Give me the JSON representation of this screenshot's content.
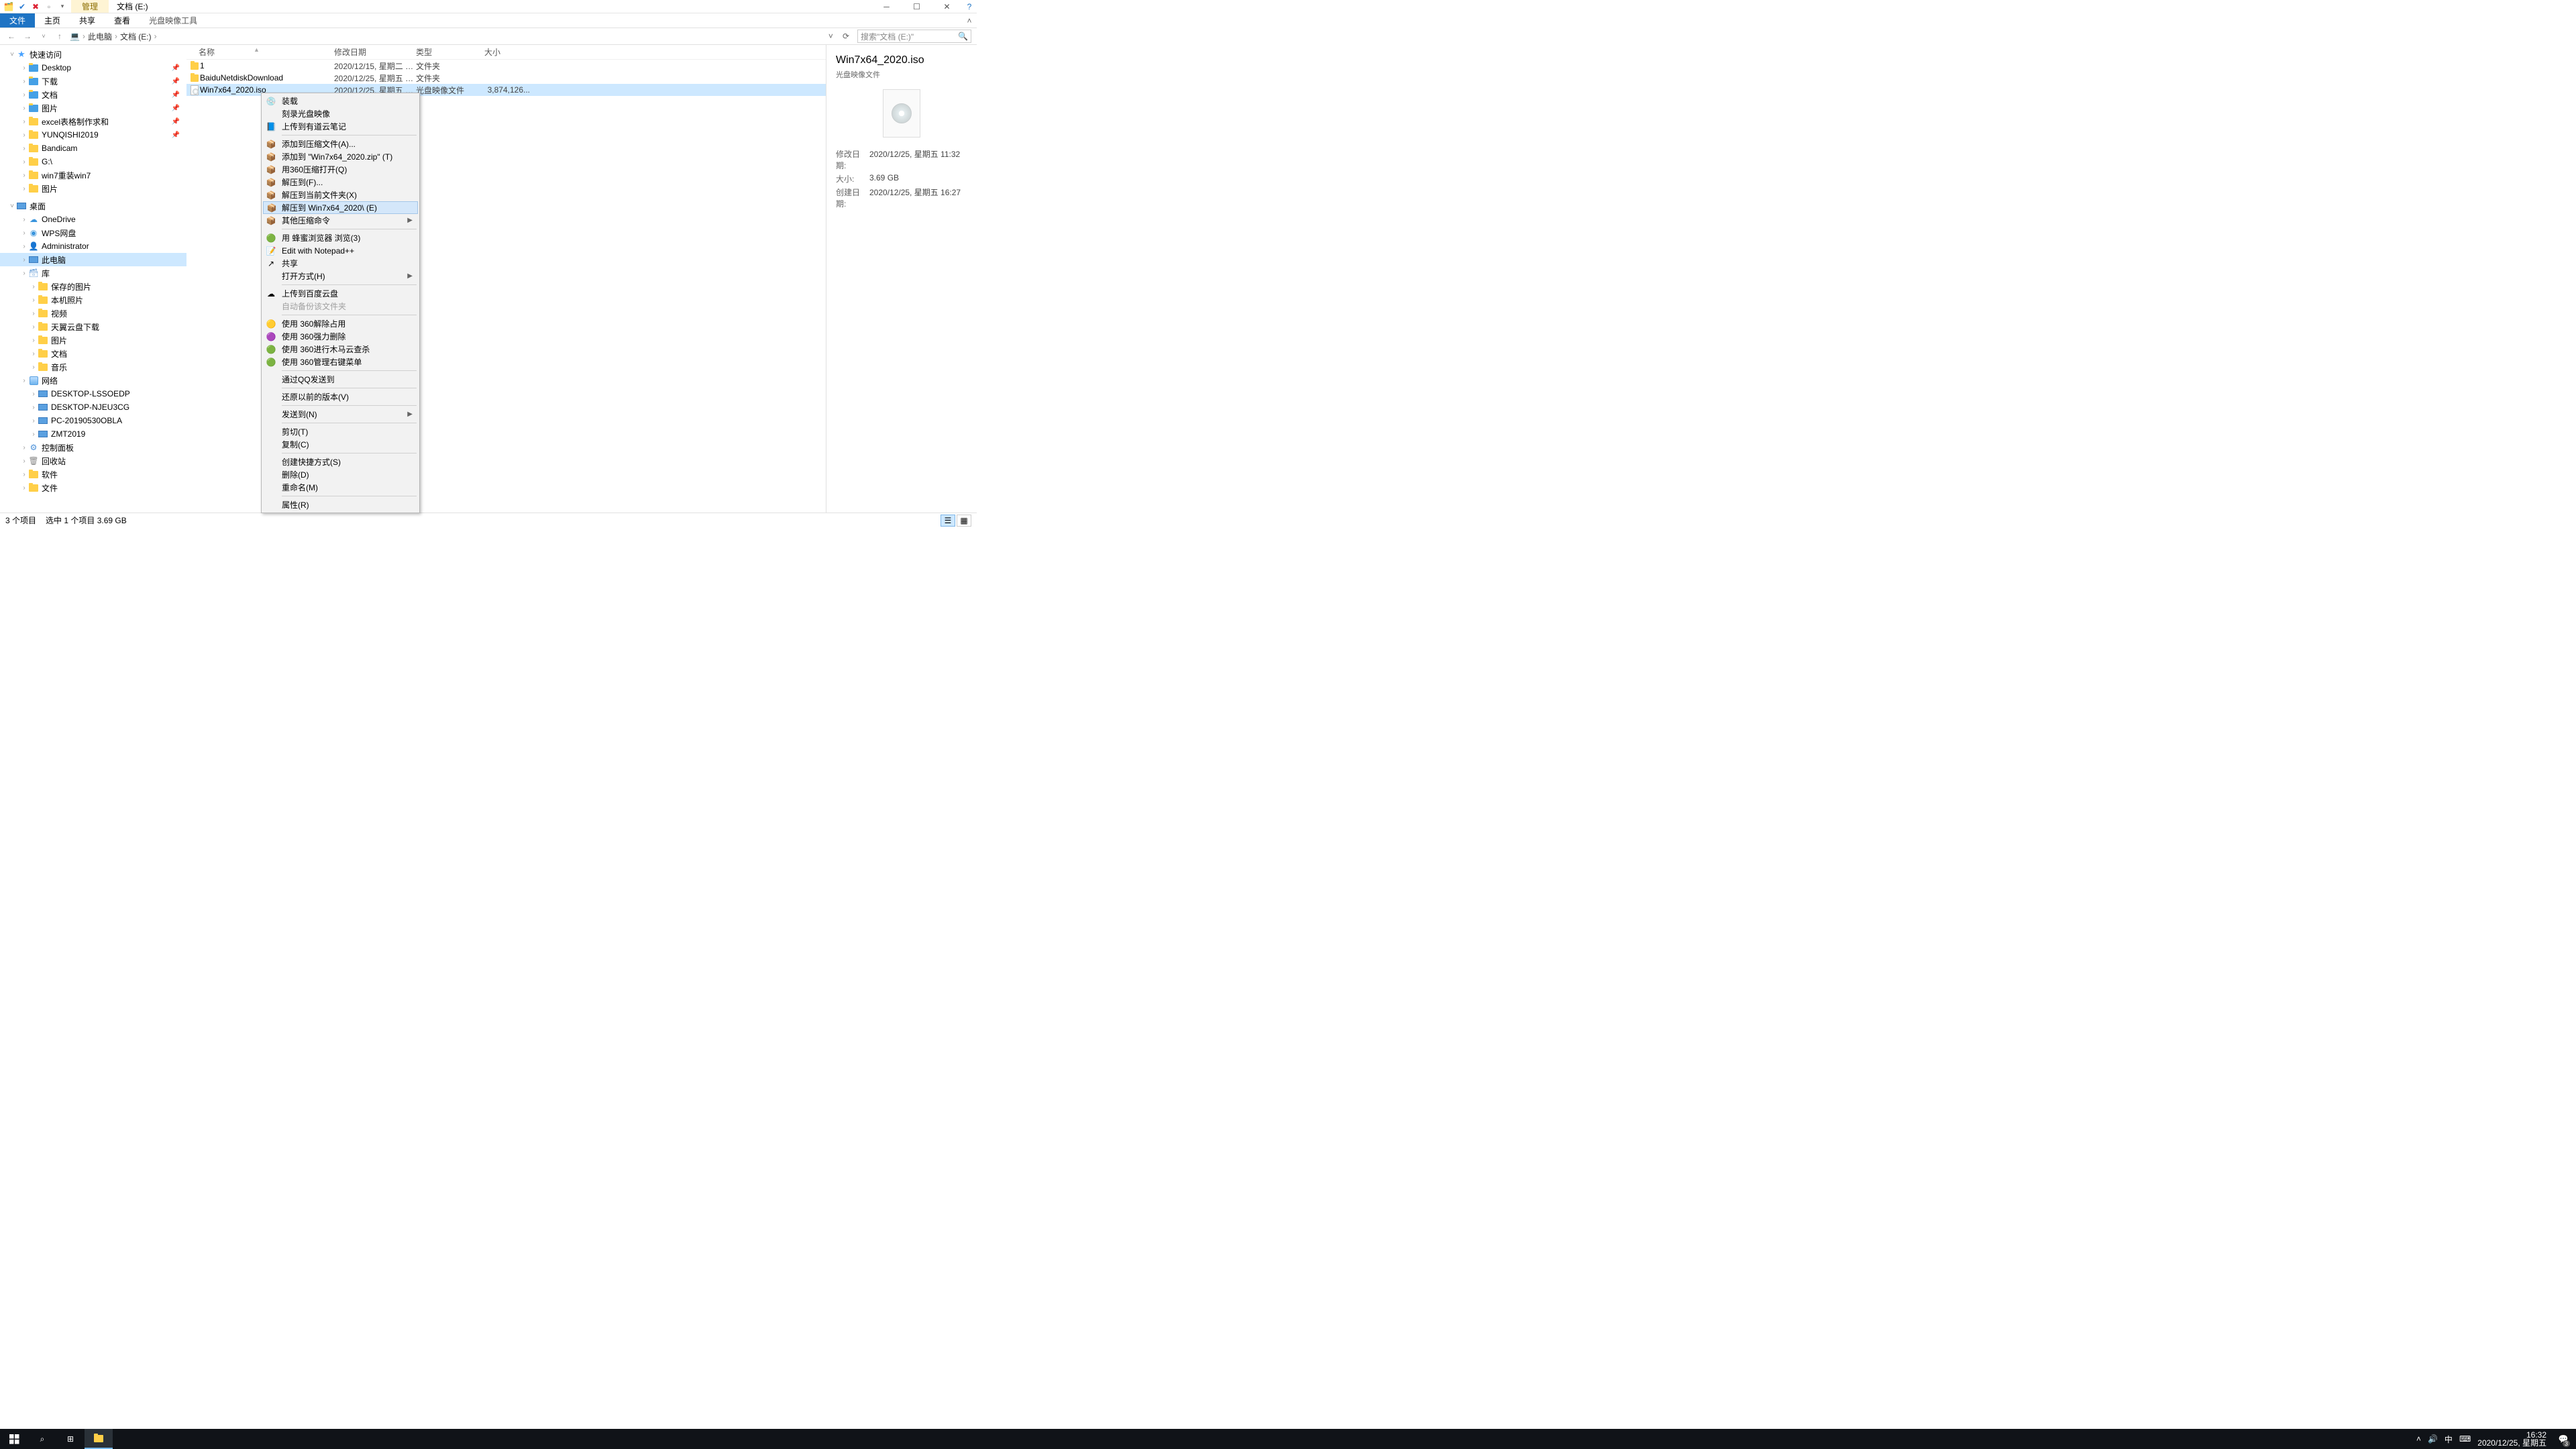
{
  "window": {
    "contextTab": "管理",
    "title": "文档 (E:)"
  },
  "ribbon": {
    "file": "文件",
    "tabs": [
      "主页",
      "共享",
      "查看"
    ],
    "contextTool": "光盘映像工具"
  },
  "nav": {
    "root": "此电脑",
    "folder": "文档 (E:)",
    "searchPlaceholder": "搜索\"文档 (E:)\""
  },
  "tree": {
    "quick": {
      "label": "快速访问",
      "items": [
        {
          "label": "Desktop",
          "pin": true,
          "color": "#45a0e6"
        },
        {
          "label": "下载",
          "pin": true,
          "color": "#45a0e6"
        },
        {
          "label": "文档",
          "pin": true,
          "color": "#45a0e6"
        },
        {
          "label": "图片",
          "pin": true,
          "color": "#45a0e6"
        },
        {
          "label": "excel表格制作求和",
          "pin": true,
          "color": "#ffcf48"
        },
        {
          "label": "YUNQISHI2019",
          "pin": true,
          "color": "#ffcf48"
        },
        {
          "label": "Bandicam",
          "pin": false,
          "color": "#ffcf48"
        },
        {
          "label": "G:\\",
          "pin": false,
          "color": "#ffcf48"
        },
        {
          "label": "win7重装win7",
          "pin": false,
          "color": "#ffcf48"
        },
        {
          "label": "图片",
          "pin": false,
          "color": "#ffcf48"
        }
      ]
    },
    "desktop": {
      "label": "桌面",
      "items": [
        {
          "label": "OneDrive",
          "ico": "cloud"
        },
        {
          "label": "WPS网盘",
          "ico": "wps"
        },
        {
          "label": "Administrator",
          "ico": "user"
        },
        {
          "label": "此电脑",
          "ico": "pc",
          "sel": true
        },
        {
          "label": "库",
          "ico": "lib"
        },
        {
          "label": "保存的图片",
          "ico": "folder",
          "indent": 1
        },
        {
          "label": "本机照片",
          "ico": "folder",
          "indent": 1
        },
        {
          "label": "视频",
          "ico": "folder",
          "indent": 1
        },
        {
          "label": "天翼云盘下载",
          "ico": "folder",
          "indent": 1
        },
        {
          "label": "图片",
          "ico": "folder",
          "indent": 1
        },
        {
          "label": "文档",
          "ico": "folder",
          "indent": 1
        },
        {
          "label": "音乐",
          "ico": "folder",
          "indent": 1
        },
        {
          "label": "网络",
          "ico": "net"
        },
        {
          "label": "DESKTOP-LSSOEDP",
          "ico": "pc",
          "indent": 1
        },
        {
          "label": "DESKTOP-NJEU3CG",
          "ico": "pc",
          "indent": 1
        },
        {
          "label": "PC-20190530OBLA",
          "ico": "pc",
          "indent": 1
        },
        {
          "label": "ZMT2019",
          "ico": "pc",
          "indent": 1
        },
        {
          "label": "控制面板",
          "ico": "cp"
        },
        {
          "label": "回收站",
          "ico": "bin"
        },
        {
          "label": "软件",
          "ico": "folder"
        },
        {
          "label": "文件",
          "ico": "folder"
        }
      ]
    }
  },
  "columns": {
    "name": "名称",
    "date": "修改日期",
    "type": "类型",
    "size": "大小"
  },
  "files": [
    {
      "name": "1",
      "date": "2020/12/15, 星期二 1...",
      "type": "文件夹",
      "size": "",
      "ico": "folder"
    },
    {
      "name": "BaiduNetdiskDownload",
      "date": "2020/12/25, 星期五 1...",
      "type": "文件夹",
      "size": "",
      "ico": "folder"
    },
    {
      "name": "Win7x64_2020.iso",
      "date": "2020/12/25, 星期五 1...",
      "type": "光盘映像文件",
      "size": "3,874,126...",
      "ico": "iso",
      "sel": true
    }
  ],
  "ctx": [
    {
      "t": "装载",
      "i": "disc"
    },
    {
      "t": "刻录光盘映像"
    },
    {
      "t": "上传到有道云笔记",
      "i": "blue"
    },
    {
      "sep": true
    },
    {
      "t": "添加到压缩文件(A)...",
      "i": "zip"
    },
    {
      "t": "添加到 \"Win7x64_2020.zip\" (T)",
      "i": "zip"
    },
    {
      "t": "用360压缩打开(Q)",
      "i": "zip"
    },
    {
      "t": "解压到(F)...",
      "i": "zip"
    },
    {
      "t": "解压到当前文件夹(X)",
      "i": "zip"
    },
    {
      "t": "解压到 Win7x64_2020\\ (E)",
      "i": "zip",
      "hover": true
    },
    {
      "t": "其他压缩命令",
      "i": "zip",
      "sub": true
    },
    {
      "sep": true
    },
    {
      "t": "用 蜂蜜浏览器 浏览(3)",
      "i": "green"
    },
    {
      "t": "Edit with Notepad++",
      "i": "npp"
    },
    {
      "t": "共享",
      "i": "share"
    },
    {
      "t": "打开方式(H)",
      "sub": true
    },
    {
      "sep": true
    },
    {
      "t": "上传到百度云盘",
      "i": "baidu"
    },
    {
      "t": "自动备份该文件夹",
      "disabled": true
    },
    {
      "sep": true
    },
    {
      "t": "使用 360解除占用",
      "i": "360y"
    },
    {
      "t": "使用 360强力删除",
      "i": "360p"
    },
    {
      "t": "使用 360进行木马云查杀",
      "i": "360g"
    },
    {
      "t": "使用 360管理右键菜单",
      "i": "360g"
    },
    {
      "sep": true
    },
    {
      "t": "通过QQ发送到"
    },
    {
      "sep": true
    },
    {
      "t": "还原以前的版本(V)"
    },
    {
      "sep": true
    },
    {
      "t": "发送到(N)",
      "sub": true
    },
    {
      "sep": true
    },
    {
      "t": "剪切(T)"
    },
    {
      "t": "复制(C)"
    },
    {
      "sep": true
    },
    {
      "t": "创建快捷方式(S)"
    },
    {
      "t": "删除(D)"
    },
    {
      "t": "重命名(M)"
    },
    {
      "sep": true
    },
    {
      "t": "属性(R)"
    }
  ],
  "details": {
    "title": "Win7x64_2020.iso",
    "subtitle": "光盘映像文件",
    "props": [
      {
        "k": "修改日期:",
        "v": "2020/12/25, 星期五 11:32"
      },
      {
        "k": "大小:",
        "v": "3.69 GB"
      },
      {
        "k": "创建日期:",
        "v": "2020/12/25, 星期五 16:27"
      }
    ]
  },
  "status": {
    "count": "3 个项目",
    "sel": "选中 1 个项目  3.69 GB"
  },
  "taskbar": {
    "ime": "中",
    "time": "16:32",
    "date": "2020/12/25, 星期五",
    "badge": "3"
  }
}
